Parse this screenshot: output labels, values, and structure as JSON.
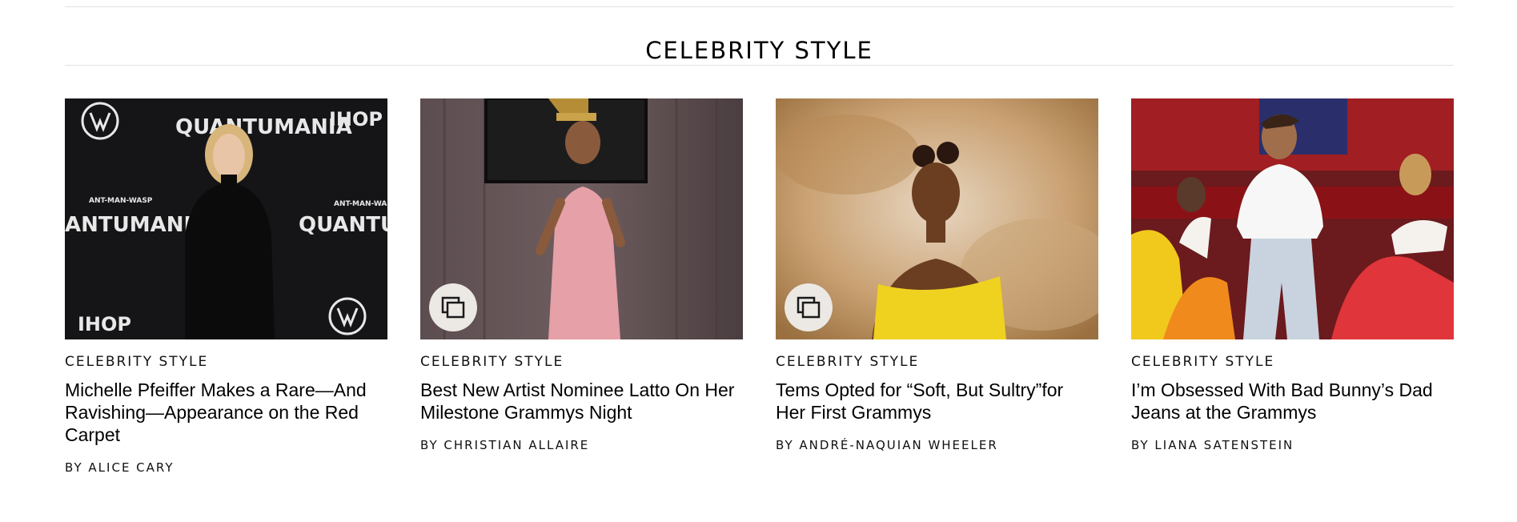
{
  "section": {
    "title": "CELEBRITY STYLE"
  },
  "cards": [
    {
      "rubric": "CELEBRITY STYLE",
      "headline": "Michelle Pfeiffer Makes a Rare—And Ravishing—Appearance on the Red Carpet",
      "byline_prefix": "BY",
      "author": "ALICE CARY",
      "gallery": false,
      "backdrop_text": {
        "big1": "QUANTUMANIA",
        "big2": "ANTUMANIA",
        "big3": "QUANTUMA",
        "small": "ANT-MAN-WASP",
        "logo": "IHOP"
      }
    },
    {
      "rubric": "CELEBRITY STYLE",
      "headline": "Best New Artist Nominee Latto On Her Milestone Grammys Night",
      "byline_prefix": "BY",
      "author": "CHRISTIAN ALLAIRE",
      "gallery": true
    },
    {
      "rubric": "CELEBRITY STYLE",
      "headline": "Tems Opted for “Soft, But Sultry”for Her First Grammys",
      "byline_prefix": "BY",
      "author": "ANDRÉ-NAQUIAN WHEELER",
      "gallery": true
    },
    {
      "rubric": "CELEBRITY STYLE",
      "headline": "I’m Obsessed With Bad Bunny’s Dad Jeans at the Grammys",
      "byline_prefix": "BY",
      "author": "LIANA SATENSTEIN",
      "gallery": false
    }
  ],
  "colors": {
    "rule": "#e2e2e2",
    "badge": "#ece8e4",
    "text": "#000000"
  },
  "icons": {
    "gallery": "gallery-stack-icon"
  }
}
